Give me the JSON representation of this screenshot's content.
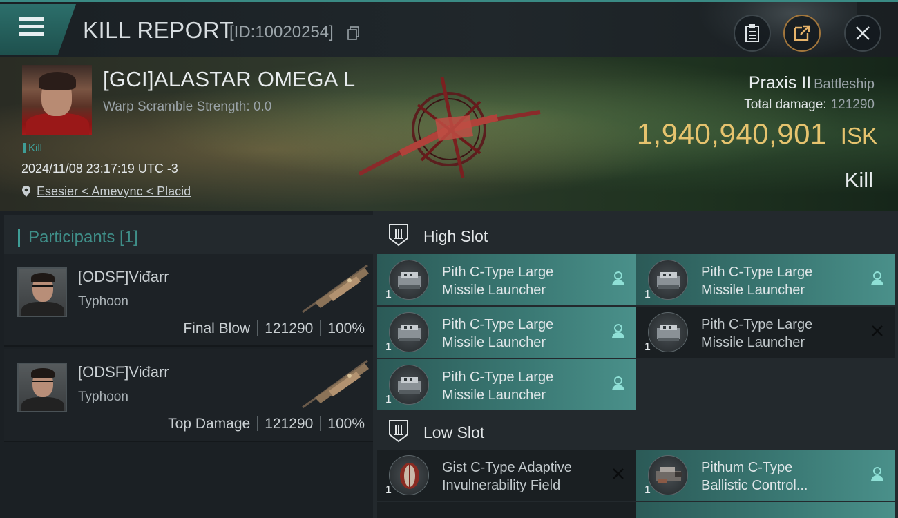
{
  "header": {
    "title": "KILL REPORT",
    "report_id": "[ID:10020254]",
    "icons": [
      "menu-icon",
      "copy-icon",
      "clipboard-icon",
      "share-icon",
      "close-icon"
    ]
  },
  "victim": {
    "name": "[GCI]ALASTAR OMEGA L",
    "scramble": "Warp Scramble Strength: 0.0",
    "tag": "Kill",
    "datetime": "2024/11/08 23:17:19 UTC -3",
    "location": "Esesier < Amevync < Placid",
    "ship_name": "Praxis II",
    "ship_class": "Battleship",
    "total_damage_label": "Total damage:",
    "total_damage": "121290",
    "isk_value": "1,940,940,901",
    "isk_unit": "ISK",
    "result": "Kill"
  },
  "participants": {
    "title": "Participants [1]",
    "rows": [
      {
        "name": "[ODSF]Viđarr",
        "ship": "Typhoon",
        "role": "Final Blow",
        "damage": "121290",
        "percent": "100%"
      },
      {
        "name": "[ODSF]Viđarr",
        "ship": "Typhoon",
        "role": "Top Damage",
        "damage": "121290",
        "percent": "100%"
      }
    ]
  },
  "slots": {
    "high": {
      "title": "High Slot",
      "items": [
        {
          "line1": "Pith C-Type Large",
          "line2": "Missile Launcher",
          "qty": "1",
          "state": "dropped"
        },
        {
          "line1": "Pith C-Type Large",
          "line2": "Missile Launcher",
          "qty": "1",
          "state": "dropped"
        },
        {
          "line1": "Pith C-Type Large",
          "line2": "Missile Launcher",
          "qty": "1",
          "state": "dropped"
        },
        {
          "line1": "Pith C-Type Large",
          "line2": "Missile Launcher",
          "qty": "1",
          "state": "destroyed"
        },
        {
          "line1": "Pith C-Type Large",
          "line2": "Missile Launcher",
          "qty": "1",
          "state": "dropped"
        }
      ]
    },
    "low": {
      "title": "Low Slot",
      "items": [
        {
          "line1": "Gist C-Type Adaptive",
          "line2": "Invulnerability Field",
          "qty": "1",
          "state": "destroyed"
        },
        {
          "line1": "Pithum C-Type",
          "line2": "Ballistic Control...",
          "qty": "1",
          "state": "dropped"
        }
      ]
    }
  },
  "colors": {
    "accent": "#3f9d96",
    "isk_gold": "#e6c36e",
    "dropped_item": "#3b7a75",
    "destroyed_item": "#1a1f22"
  }
}
